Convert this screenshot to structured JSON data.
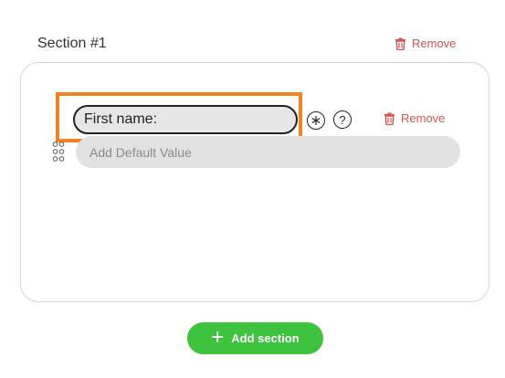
{
  "section": {
    "title": "Section #1",
    "remove_label": "Remove"
  },
  "field": {
    "label_value": "First name:",
    "required_symbol": "*",
    "help_symbol": "?",
    "remove_label": "Remove",
    "default_placeholder": "Add Default Value"
  },
  "actions": {
    "add_section_label": "Add section",
    "add_section_icon": "+"
  },
  "icons": {
    "trash": "trash-icon",
    "drag": "drag-handle-icon",
    "plus": "plus-icon"
  },
  "colors": {
    "remove": "#d9534f",
    "highlight": "#f58220",
    "add_button": "#3ec33e",
    "field_bg": "#e2e2e2"
  }
}
